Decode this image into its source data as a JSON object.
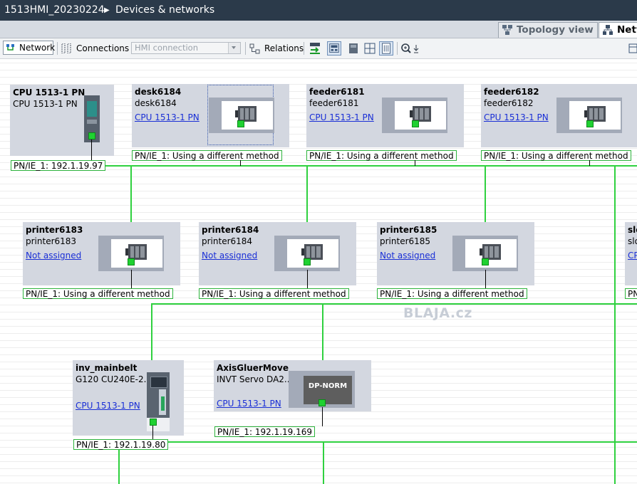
{
  "window": {
    "project": "1513HMI_20230224",
    "section": "Devices & networks"
  },
  "tabs": [
    {
      "label": "Topology view",
      "active": false
    },
    {
      "label": "Netw",
      "active": true
    }
  ],
  "toolbar": {
    "network_label": "Network",
    "connections_label": "Connections",
    "connection_type": "HMI connection",
    "relations_label": "Relations"
  },
  "watermark": "BLAJA.cz",
  "devices": {
    "cpu": {
      "name": "CPU 1513-1 PN",
      "type": "CPU 1513-1 PN",
      "interface": "PN/IE_1:  192.1.19.97"
    },
    "desk6184": {
      "name": "desk6184",
      "type": "desk6184",
      "assignment": "CPU 1513-1 PN",
      "interface": "PN/IE_1:  Using a different method"
    },
    "feeder6181": {
      "name": "feeder6181",
      "type": "feeder6181",
      "assignment": "CPU 1513-1 PN",
      "interface": "PN/IE_1:  Using a different method"
    },
    "feeder6182": {
      "name": "feeder6182",
      "type": "feeder6182",
      "assignment": "CPU 1513-1 PN",
      "interface": "PN/IE_1:  Using a different method"
    },
    "printer6183": {
      "name": "printer6183",
      "type": "printer6183",
      "assignment": "Not assigned",
      "interface": "PN/IE_1:  Using a different method"
    },
    "printer6184": {
      "name": "printer6184",
      "type": "printer6184",
      "assignment": "Not assigned",
      "interface": "PN/IE_1:  Using a different method"
    },
    "printer6185": {
      "name": "printer6185",
      "type": "printer6185",
      "assignment": "Not assigned",
      "interface": "PN/IE_1:  Using a different method"
    },
    "partial": {
      "name": "slo",
      "type": "slo",
      "assignment": "CP",
      "interface": "PN"
    },
    "inv_mainbelt": {
      "name": "inv_mainbelt",
      "type": "G120  CU240E-2...",
      "assignment": "CPU 1513-1 PN",
      "interface": "PN/IE_1:  192.1.19.80"
    },
    "axis": {
      "name": "AxisGluerMove",
      "type": "INVT Servo DA2...",
      "assignment": "CPU 1513-1 PN",
      "interface": "PN/IE_1:  192.1.19.169",
      "module_label": "DP-NORM"
    }
  },
  "colors": {
    "network_line": "#2fd13f",
    "device_bg": "#d3d7e0",
    "title_bg": "#2b3a4a",
    "link": "#1a2fd6"
  },
  "icons": [
    "topology-icon",
    "network-icon",
    "connections-icon",
    "relations-icon",
    "zoom-icon"
  ]
}
